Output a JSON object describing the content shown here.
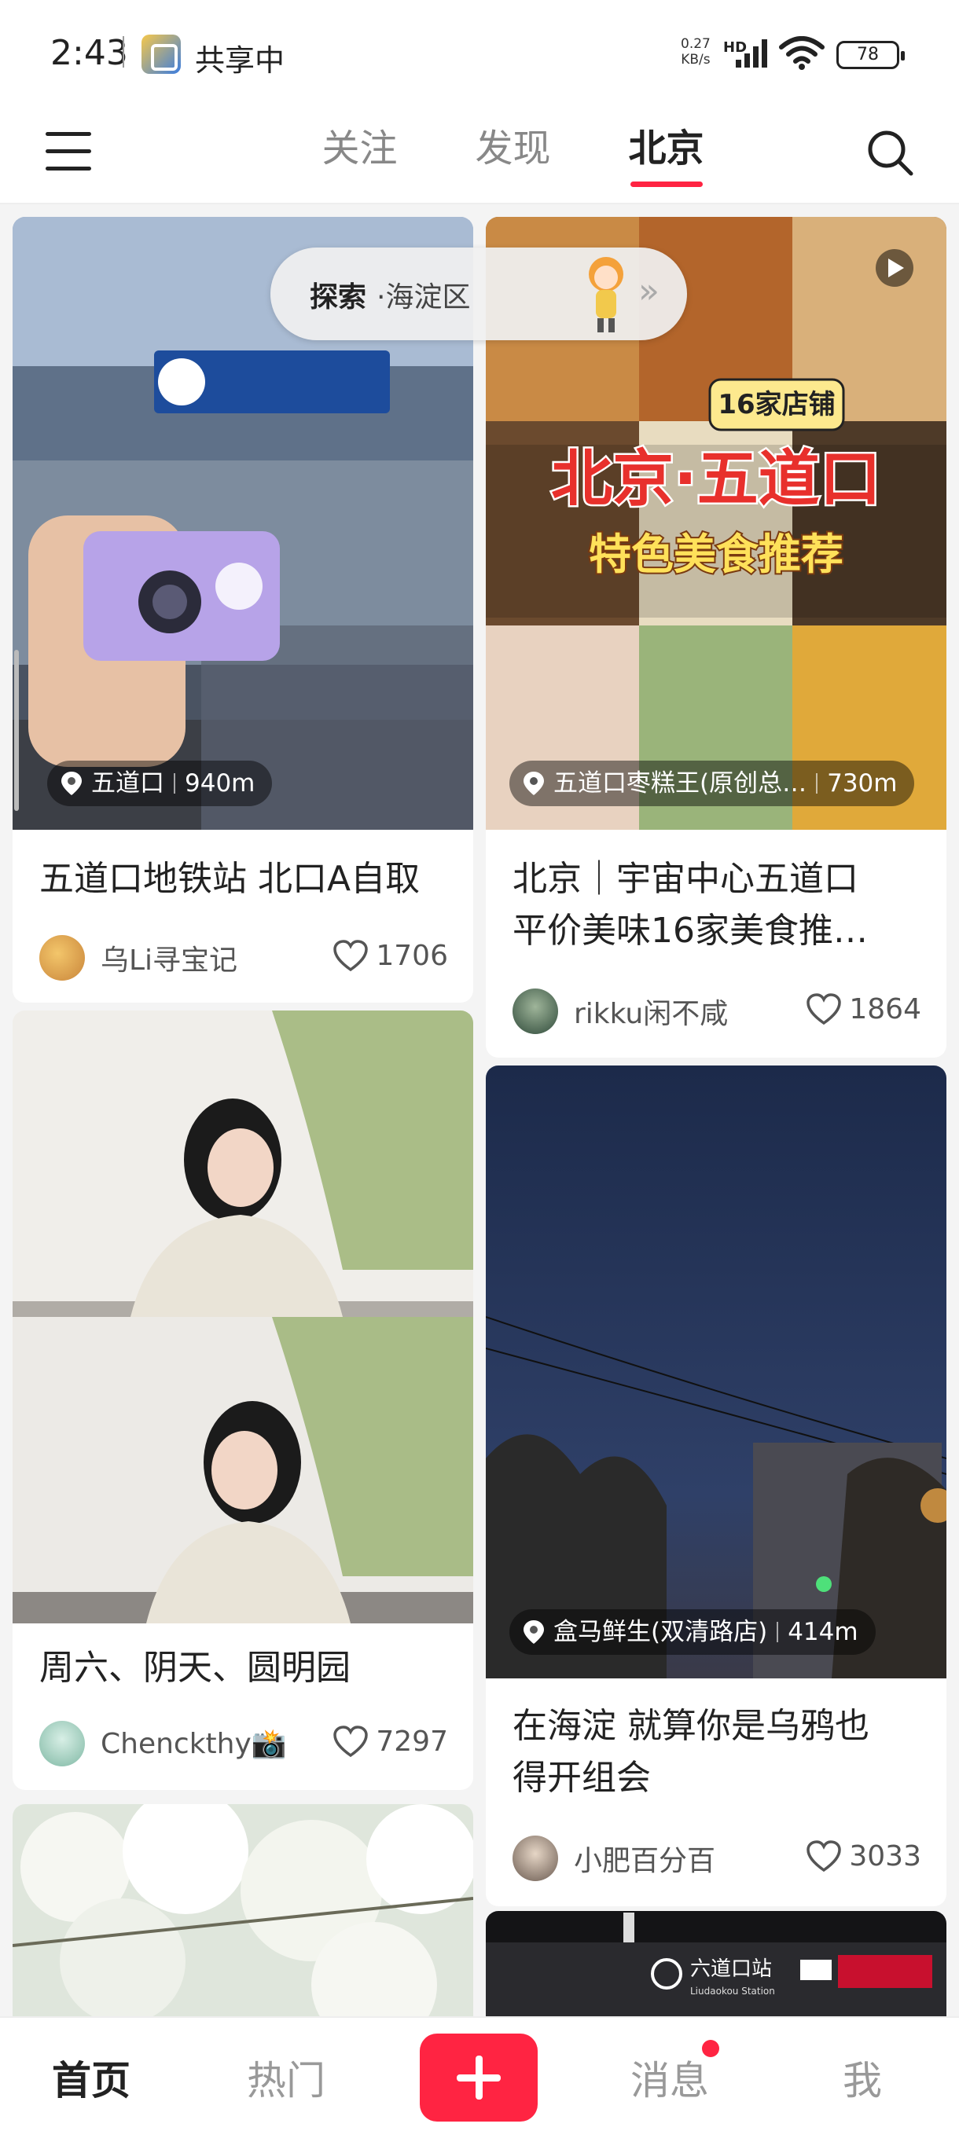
{
  "status_bar": {
    "time": "2:43",
    "app_label": "共享中",
    "net_rate": "0.27",
    "net_unit": "KB/s",
    "hd": "HD",
    "battery": "78"
  },
  "top_nav": {
    "tabs": [
      "关注",
      "发现",
      "北京"
    ],
    "active_tab": "北京"
  },
  "explore_pill": {
    "label": "探索",
    "separator": "·",
    "area": "海淀区"
  },
  "feed": {
    "left": [
      {
        "location": "五道口",
        "distance": "940m",
        "title": "五道口地铁站 北口A自取",
        "author": "乌Li寻宝记",
        "likes": "1706"
      },
      {
        "title": "周六、阴天、圆明园",
        "author": "Chenckthy📸",
        "likes": "7297"
      }
    ],
    "right": [
      {
        "location": "五道口枣糕王(原创总…",
        "distance": "730m",
        "cover_badge": "16家店铺",
        "cover_title": "北京·五道口",
        "cover_subtitle": "特色美食推荐",
        "title_line1": "北京｜宇宙中心五道口",
        "title_line2": "平价美味16家美食推…",
        "author": "rikku闲不咸",
        "likes": "1864"
      },
      {
        "location": "盒马鲜生(双清路店)",
        "distance": "414m",
        "title_line1": "在海淀 就算你是乌鸦也",
        "title_line2": "得开组会",
        "author": "小肥百分百",
        "likes": "3033"
      },
      {
        "cover_sign": "六道口站",
        "cover_sign_en": "Liudaokou Station"
      }
    ]
  },
  "bottom_nav": {
    "home": "首页",
    "hot": "热门",
    "messages": "消息",
    "me": "我"
  },
  "colors": {
    "accent": "#ff2442",
    "background": "#f4f4f4"
  }
}
